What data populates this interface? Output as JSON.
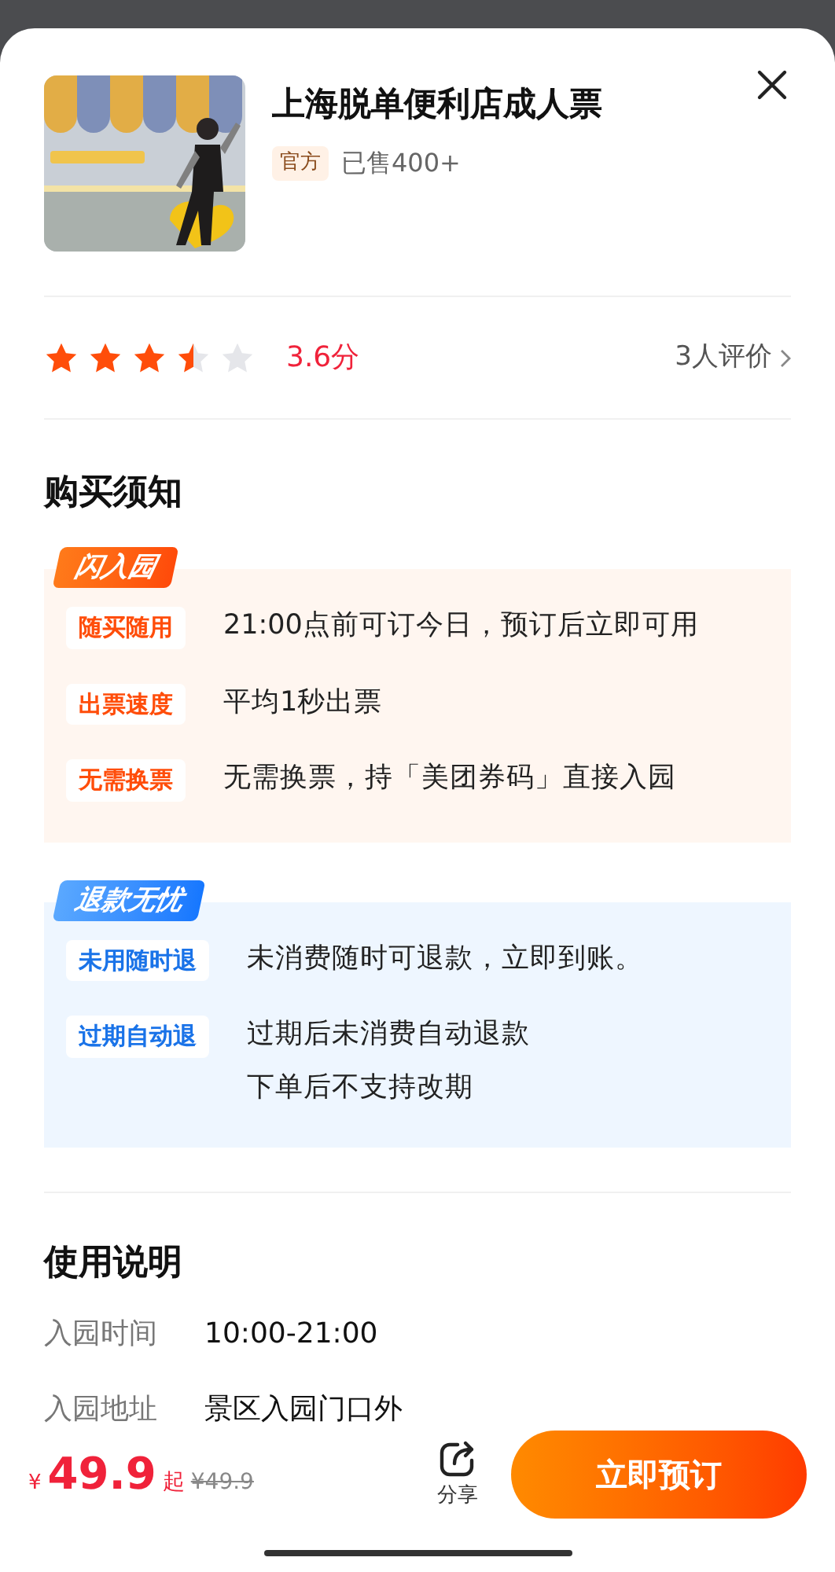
{
  "product": {
    "title": "上海脱单便利店成人票",
    "badge": "官方",
    "sold": "已售400+"
  },
  "rating": {
    "stars": 3.5,
    "score": "3.6分",
    "reviews": "3人评价"
  },
  "notice": {
    "heading": "购买须知",
    "groups": [
      {
        "kind": "orange",
        "tag": "闪入园",
        "rows": [
          {
            "label": "随买随用",
            "lines": [
              "21:00点前可订今日，预订后立即可用"
            ]
          },
          {
            "label": "出票速度",
            "lines": [
              "平均1秒出票"
            ]
          },
          {
            "label": "无需换票",
            "lines": [
              "无需换票，持「美团券码」直接入园"
            ]
          }
        ]
      },
      {
        "kind": "blue",
        "tag": "退款无忧",
        "rows": [
          {
            "label": "未用随时退",
            "lines": [
              "未消费随时可退款，立即到账。"
            ]
          },
          {
            "label": "过期自动退",
            "lines": [
              "过期后未消费自动退款",
              "下单后不支持改期"
            ]
          }
        ]
      }
    ]
  },
  "usage": {
    "heading": "使用说明",
    "rows": [
      {
        "label": "入园时间",
        "value": "10:00-21:00"
      },
      {
        "label": "入园地址",
        "value": "景区入园门口外"
      }
    ]
  },
  "footer": {
    "currency": "¥",
    "price": "49.9",
    "suffix": "起",
    "original": "¥49.9",
    "share": "分享",
    "book": "立即预订"
  }
}
